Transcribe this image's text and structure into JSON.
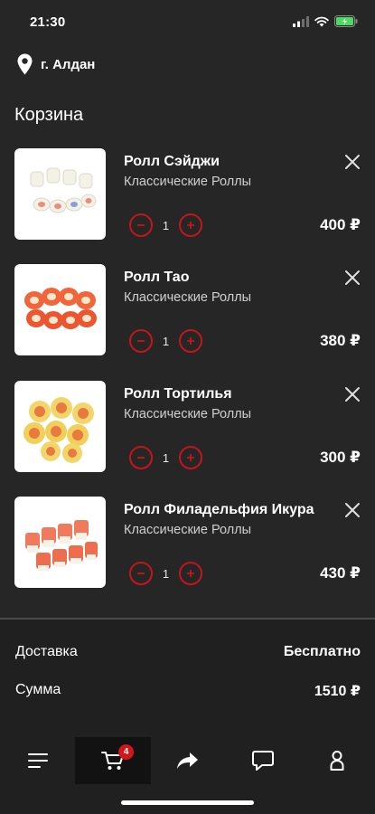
{
  "status_bar": {
    "time": "21:30"
  },
  "location": {
    "city": "г. Алдан"
  },
  "page": {
    "title": "Корзина"
  },
  "cart": {
    "items": [
      {
        "name": "Ролл Сэйджи",
        "category": "Классические Роллы",
        "quantity": "1",
        "price": "400 ₽"
      },
      {
        "name": "Ролл Тао",
        "category": "Классические Роллы",
        "quantity": "1",
        "price": "380 ₽"
      },
      {
        "name": "Ролл Тортилья",
        "category": "Классические Роллы",
        "quantity": "1",
        "price": "300 ₽"
      },
      {
        "name": "Ролл Филадельфия Икура",
        "category": "Классические Роллы",
        "quantity": "1",
        "price": "430 ₽"
      }
    ]
  },
  "summary": {
    "delivery_label": "Доставка",
    "delivery_value": "Бесплатно",
    "total_label": "Сумма",
    "total_value": "1510 ₽"
  },
  "bottom_nav": {
    "cart_badge": "4"
  },
  "icons": {
    "location": "location-pin-icon",
    "remove": "close-icon",
    "decrease": "minus-icon",
    "increase": "plus-icon",
    "menu": "menu-icon",
    "cart": "cart-icon",
    "share": "share-icon",
    "chat": "chat-icon",
    "profile": "profile-icon"
  },
  "colors": {
    "background": "#262626",
    "accent": "#c4151c",
    "badge": "#d3151d",
    "text": "#ffffff",
    "battery": "#4cd964"
  }
}
